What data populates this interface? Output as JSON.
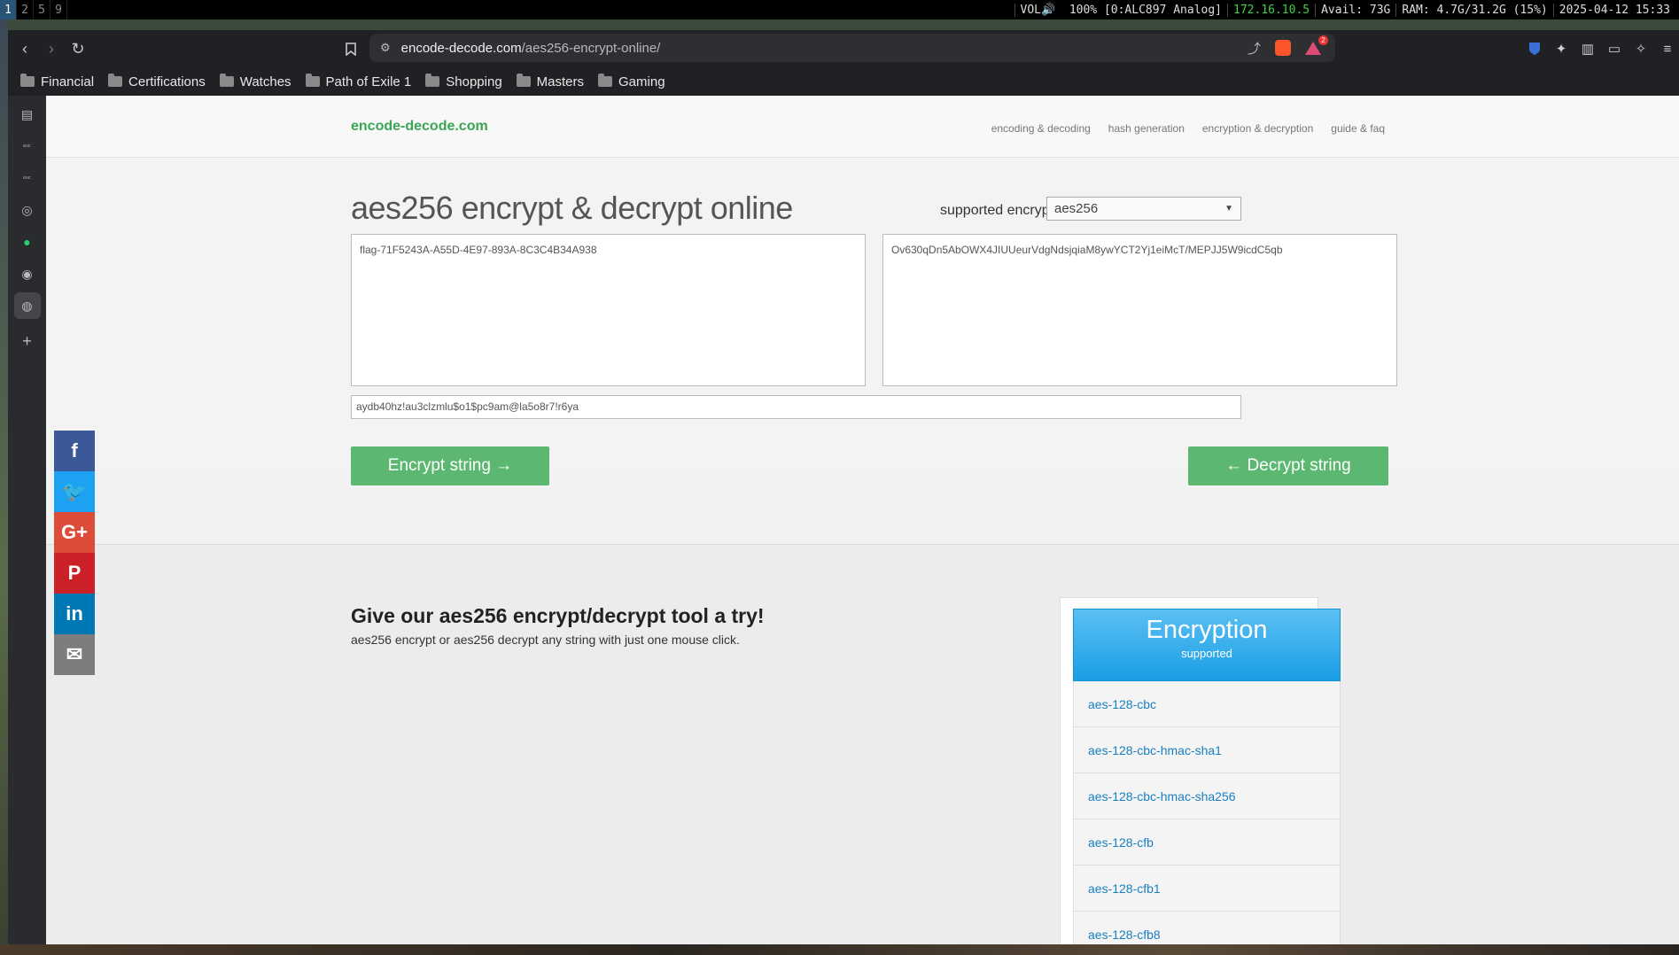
{
  "statusbar": {
    "workspaces": [
      "1",
      "2",
      "5",
      "9"
    ],
    "volume": "VOL🔊  100% [0:ALC897 Analog]",
    "ip": "172.16.10.5",
    "disk": "Avail: 73G",
    "ram": "RAM: 4.7G/31.2G (15%)",
    "datetime": "2025-04-12 15:33"
  },
  "browser": {
    "url_domain": "encode-decode.com",
    "url_path": "/aes256-encrypt-online/",
    "bookmarks": [
      "Financial",
      "Certifications",
      "Watches",
      "Path of Exile 1",
      "Shopping",
      "Masters",
      "Gaming"
    ],
    "shield_badge": "2"
  },
  "site": {
    "logo": "encode-decode.com",
    "nav": [
      "encoding & decoding",
      "hash generation",
      "encryption & decryption",
      "guide & faq"
    ]
  },
  "main": {
    "title": "aes256 encrypt & decrypt online",
    "enc_label": "supported encryptions:",
    "enc_selected": "aes256",
    "input_text": "flag-71F5243A-A55D-4E97-893A-8C3C4B34A938",
    "output_text": "Ov630qDn5AbOWX4JIUUeurVdgNdsjqiaM8ywYCT2Yj1eiMcT/MEPJJ5W9icdC5qb",
    "key": "aydb40hz!au3clzmlu$o1$pc9am@la5o8r7!r6ya",
    "encrypt_label": "Encrypt string →",
    "decrypt_label": "← Decrypt string"
  },
  "lower": {
    "title": "Give our aes256 encrypt/decrypt tool a try!",
    "subtitle": "aes256 encrypt or aes256 decrypt any string with just one mouse click.",
    "panel_title": "Encryption",
    "panel_sub": "supported",
    "encryptions": [
      "aes-128-cbc",
      "aes-128-cbc-hmac-sha1",
      "aes-128-cbc-hmac-sha256",
      "aes-128-cfb",
      "aes-128-cfb1",
      "aes-128-cfb8"
    ]
  },
  "social": [
    {
      "name": "facebook",
      "glyph": "f",
      "color": "#3b5998"
    },
    {
      "name": "twitter",
      "glyph": "🐦",
      "color": "#1da1f2"
    },
    {
      "name": "google-plus",
      "glyph": "G+",
      "color": "#dd4b39"
    },
    {
      "name": "pinterest",
      "glyph": "P",
      "color": "#cb2027"
    },
    {
      "name": "linkedin",
      "glyph": "in",
      "color": "#0077b5"
    },
    {
      "name": "email",
      "glyph": "✉",
      "color": "#7d7d7d"
    }
  ]
}
